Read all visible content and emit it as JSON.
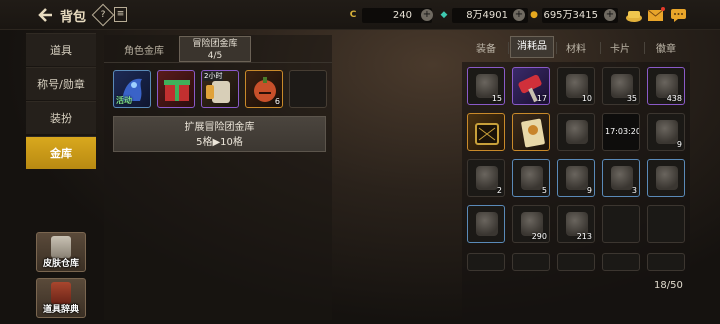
{
  "header": {
    "title": "背包",
    "help_icon": "?",
    "doc_icon": "≡",
    "currencies": [
      {
        "name": "gold-coin",
        "icon": "C",
        "color": "#d9b23a",
        "value": "240"
      },
      {
        "name": "gem",
        "icon": "◆",
        "color": "#3ec9b0",
        "value": "8万4901"
      },
      {
        "name": "coin",
        "icon": "●",
        "color": "#e6a81e",
        "value": "695万3415"
      }
    ]
  },
  "nav": {
    "items": [
      {
        "label": "道具"
      },
      {
        "label": "称号/勋章"
      },
      {
        "label": "装扮"
      },
      {
        "label": "金库"
      }
    ],
    "active": "金库",
    "skin_warehouse": "皮肤仓库",
    "item_dictionary": "道具辞典"
  },
  "vault": {
    "tab_character": "角色金库",
    "tab_adventure": "冒险团金库",
    "tab_adventure_count": "4/5",
    "slots": [
      {
        "label": "活动",
        "count": ""
      },
      {
        "label": "",
        "count": ""
      },
      {
        "label": "2小时",
        "count": ""
      },
      {
        "label": "",
        "count": "6"
      },
      {
        "label": "",
        "count": ""
      }
    ],
    "expand_title": "扩展冒险团金库",
    "expand_detail": "5格▶10格"
  },
  "inventory": {
    "tabs": [
      "装备",
      "消耗品",
      "材料",
      "卡片",
      "徽章"
    ],
    "active_tab": "消耗品",
    "rows": [
      [
        {
          "count": "15"
        },
        {
          "count": "17"
        },
        {
          "count": "10"
        },
        {
          "count": "35"
        },
        {
          "count": "438"
        }
      ],
      [
        {
          "count": ""
        },
        {
          "count": ""
        },
        {
          "count": ""
        },
        {
          "count": "17:03:20"
        },
        {
          "count": "9"
        }
      ],
      [
        {
          "count": "2"
        },
        {
          "count": "5"
        },
        {
          "count": "9"
        },
        {
          "count": "3"
        },
        {
          "count": ""
        }
      ],
      [
        {
          "count": ""
        },
        {
          "count": "290"
        },
        {
          "count": "213"
        },
        {
          "count": ""
        },
        {
          "count": ""
        }
      ],
      [
        {
          "count": ""
        },
        {
          "count": ""
        },
        {
          "count": ""
        },
        {
          "count": ""
        },
        {
          "count": ""
        }
      ]
    ],
    "capacity": "18/50"
  }
}
